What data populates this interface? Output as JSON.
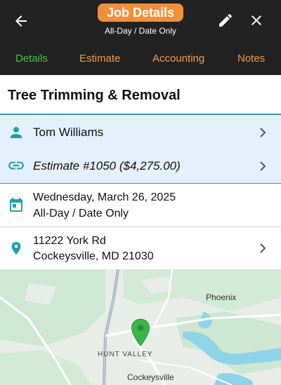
{
  "header": {
    "title": "Job Details",
    "subtitle": "All-Day / Date Only",
    "back_icon": "arrow-left-icon",
    "edit_icon": "pencil-icon",
    "close_icon": "close-icon"
  },
  "tabs": [
    {
      "label": "Details",
      "active": true
    },
    {
      "label": "Estimate",
      "active": false
    },
    {
      "label": "Accounting",
      "active": false
    },
    {
      "label": "Notes",
      "active": false
    }
  ],
  "job": {
    "title": "Tree Trimming & Removal"
  },
  "customer": {
    "name": "Tom Williams",
    "icon": "person-icon"
  },
  "estimate": {
    "label": "Estimate #1050 ($4,275.00)",
    "icon": "link-icon"
  },
  "schedule": {
    "date": "Wednesday, March 26, 2025",
    "time": "All-Day / Date Only",
    "icon": "calendar-icon"
  },
  "address": {
    "line1": "11222 York Rd",
    "line2": "Cockeysville, MD 21030",
    "icon": "location-pin-icon"
  },
  "map": {
    "labels": {
      "phoenix": "Phoenix",
      "hunt_valley": "HUNT VALLEY",
      "cockeysville": "Cockeysville"
    },
    "marker_icon": "map-marker-icon"
  },
  "colors": {
    "header_bg": "#222222",
    "accent_orange": "#f0903a",
    "tab_active": "#3fc24d",
    "icon_teal": "#1fa3a6",
    "highlight_blue": "#e4f0fc",
    "marker_green": "#3cb64a"
  }
}
